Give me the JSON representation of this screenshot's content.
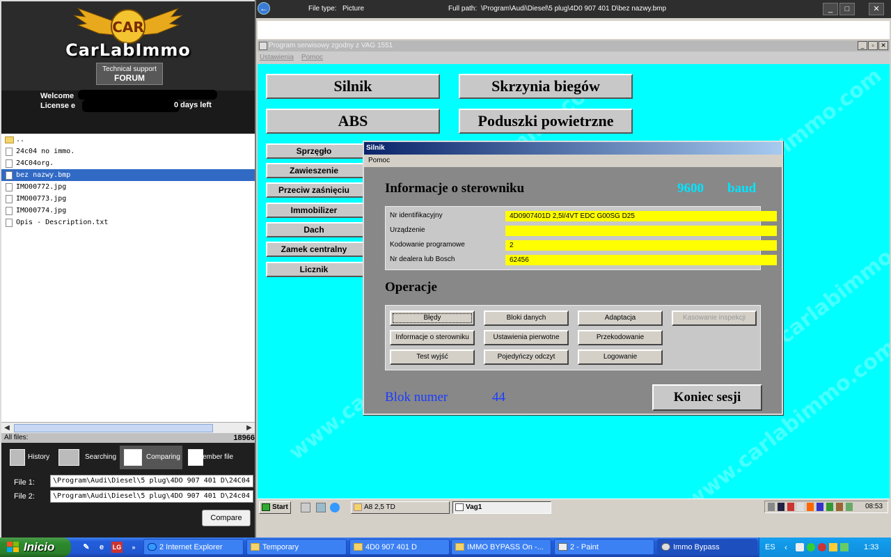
{
  "left_panel": {
    "brand": "CarLabImmo",
    "logo_text": "CAR",
    "support_line1": "Technical support",
    "support_line2": "FORUM",
    "welcome": "Welcome",
    "license": "License e",
    "license_suffix": "0 days left",
    "files": [
      {
        "name": "..",
        "type": "folder"
      },
      {
        "name": "24c04 no immo.",
        "type": "file"
      },
      {
        "name": "24C04org.",
        "type": "file"
      },
      {
        "name": "bez nazwy.bmp",
        "type": "file",
        "selected": true
      },
      {
        "name": "IMO00772.jpg",
        "type": "file"
      },
      {
        "name": "IMO00773.jpg",
        "type": "file"
      },
      {
        "name": "IMO00774.jpg",
        "type": "file"
      },
      {
        "name": "Opis - Description.txt",
        "type": "file"
      }
    ],
    "all_files_label": "All files:",
    "all_files_count": "18966",
    "tools": {
      "history": "History",
      "searching": "Searching",
      "comparing": "Comparing",
      "remember": "Remember file"
    },
    "file1_label": "File 1:",
    "file1_value": "\\Program\\Audi\\Diesel\\5 plug\\4DO 907 401 D\\24C04",
    "file2_label": "File 2:",
    "file2_value": "\\Program\\Audi\\Diesel\\5 plug\\4DO 907 401 D\\24c04",
    "compare_button": "Compare"
  },
  "viewer": {
    "file_type_label": "File type:",
    "file_type_value": "Picture",
    "full_path_label": "Full path:",
    "full_path_value": "\\Program\\Audi\\Diesel\\5 plug\\4D0 907 401 D\\bez nazwy.bmp"
  },
  "vag": {
    "title": "Program serwisowy zgodny z VAG 1551",
    "menu": [
      "Ustawienia",
      "Pomoc"
    ],
    "big_buttons": [
      "Silnik",
      "Skrzynia biegów",
      "ABS",
      "Poduszki powietrzne"
    ],
    "small_buttons": [
      "Sprzęgło",
      "Zawieszenie",
      "Przeciw zaśnięciu",
      "Immobilizer",
      "Dach",
      "Zamek centralny",
      "Licznik"
    ],
    "watermark": "www.carlabimmo.com"
  },
  "silnik": {
    "title": "Silnik",
    "menu": "Pomoc",
    "info_heading": "Informacje o sterowniku",
    "baud_value": "9600",
    "baud_unit": "baud",
    "fields": [
      {
        "label": "Nr identifikacyjny",
        "value": "4D0907401D  2,5l/4VT EDC G00SG  D25"
      },
      {
        "label": "Urządzenie",
        "value": ""
      },
      {
        "label": "Kodowanie programowe",
        "value": "2"
      },
      {
        "label": "Nr dealera lub Bosch",
        "value": "62456"
      }
    ],
    "ops_heading": "Operacje",
    "ops": [
      "Błędy",
      "Bloki danych",
      "Adaptacja",
      "Kasowanie inspekcji",
      "Informacje o sterowniku",
      "Ustawienia pierwotne",
      "Przekodowanie",
      "Test wyjść",
      "Pojedyńczy odczyt",
      "Logowanie"
    ],
    "block_label": "Blok numer",
    "block_value": "44",
    "end_button": "Koniec sesji"
  },
  "inner_taskbar": {
    "start": "Start",
    "task1": "A8 2,5 TD",
    "task2": "Vag1",
    "time": "08:53"
  },
  "xp_taskbar": {
    "start": "Inicio",
    "tasks": [
      "2 Internet Explorer",
      "Temporary",
      "4D0 907 401 D",
      "IMMO BYPASS On -...",
      "2 - Paint",
      "Immo Bypass"
    ],
    "lang": "ES",
    "time": "1:33"
  }
}
